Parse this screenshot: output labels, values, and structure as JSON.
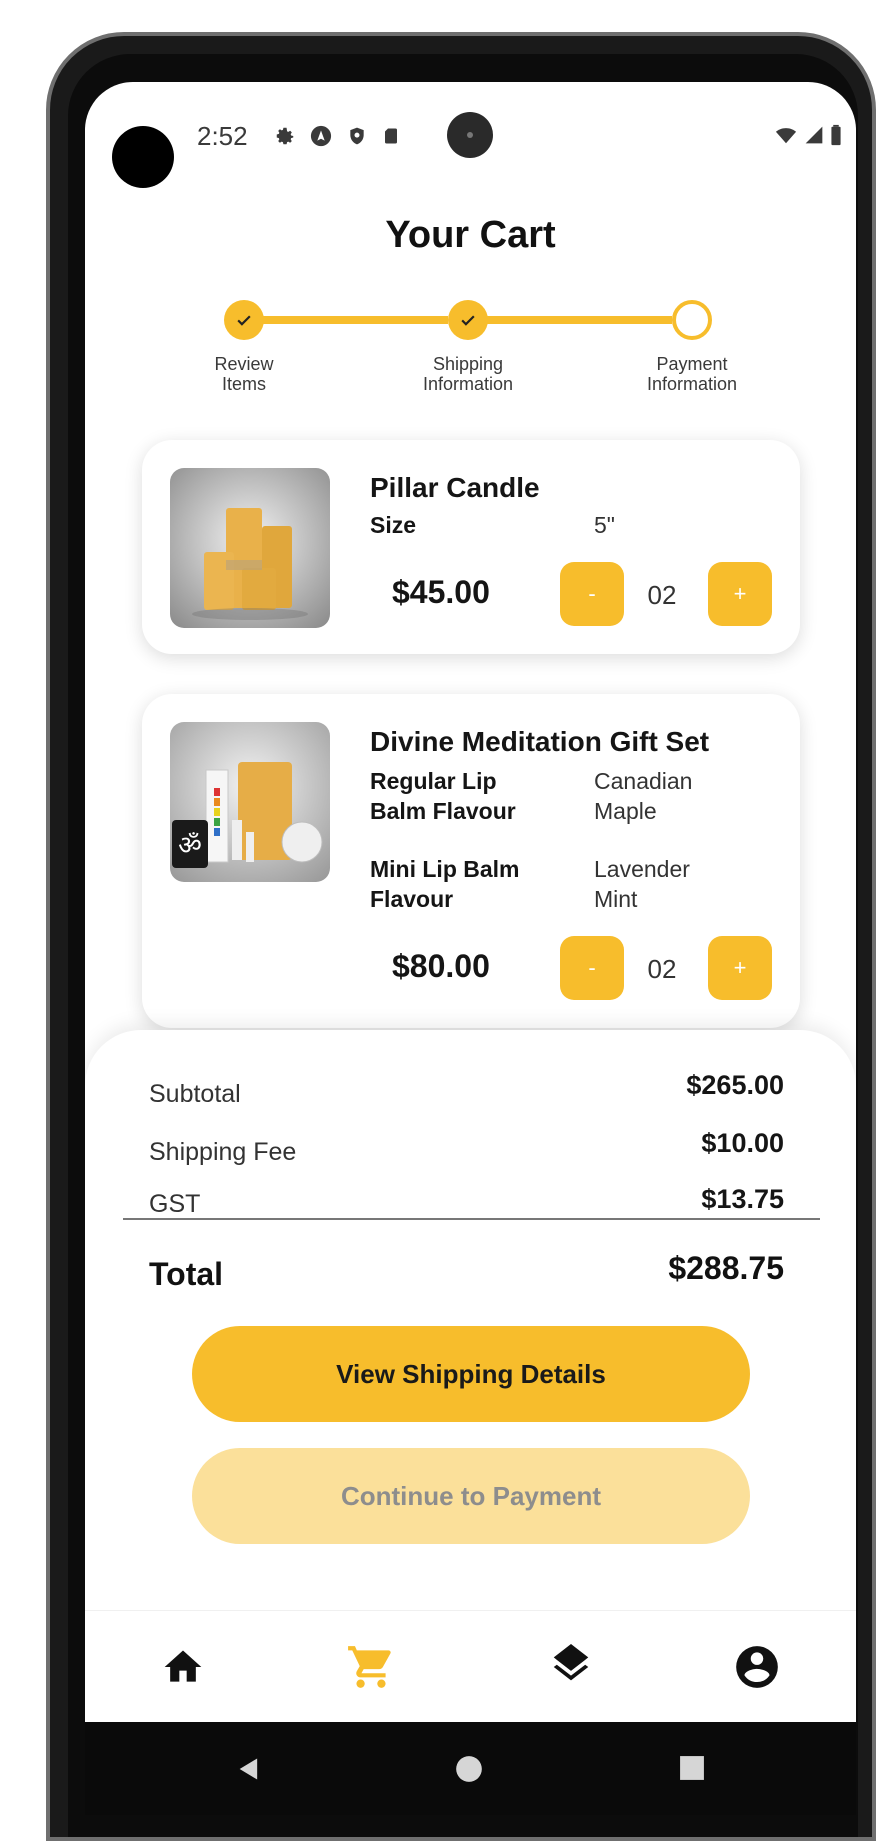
{
  "status_bar": {
    "time": "2:52"
  },
  "page": {
    "title": "Your Cart"
  },
  "stepper": {
    "steps": [
      {
        "label": "Review\nItems",
        "done": true
      },
      {
        "label": "Shipping\nInformation",
        "done": true
      },
      {
        "label": "Payment\nInformation",
        "done": false
      }
    ]
  },
  "cart": {
    "items": [
      {
        "name": "Pillar Candle",
        "options": [
          {
            "label": "Size",
            "value": "5\""
          }
        ],
        "price": "$45.00",
        "quantity": "02",
        "decrement_label": "-",
        "increment_label": "+"
      },
      {
        "name": "Divine Meditation Gift Set",
        "options": [
          {
            "label": "Regular Lip\nBalm Flavour",
            "value": "Canadian\nMaple"
          },
          {
            "label": "Mini Lip Balm\nFlavour",
            "value": "Lavender\nMint"
          }
        ],
        "price": "$80.00",
        "quantity": "02",
        "decrement_label": "-",
        "increment_label": "+"
      }
    ]
  },
  "summary": {
    "subtotal_label": "Subtotal",
    "subtotal_value": "$265.00",
    "shipping_label": "Shipping Fee",
    "shipping_value": "$10.00",
    "gst_label": "GST",
    "gst_value": "$13.75",
    "total_label": "Total",
    "total_value": "$288.75",
    "primary_button": "View Shipping Details",
    "secondary_button": "Continue to Payment"
  },
  "bottom_nav": {
    "items": [
      {
        "icon": "home-icon",
        "active": false
      },
      {
        "icon": "cart-icon",
        "active": true
      },
      {
        "icon": "layers-icon",
        "active": false
      },
      {
        "icon": "account-icon",
        "active": false
      }
    ]
  },
  "colors": {
    "accent": "#f7bd2c",
    "accent_light": "#fbe09a",
    "text_dark": "#151515"
  }
}
